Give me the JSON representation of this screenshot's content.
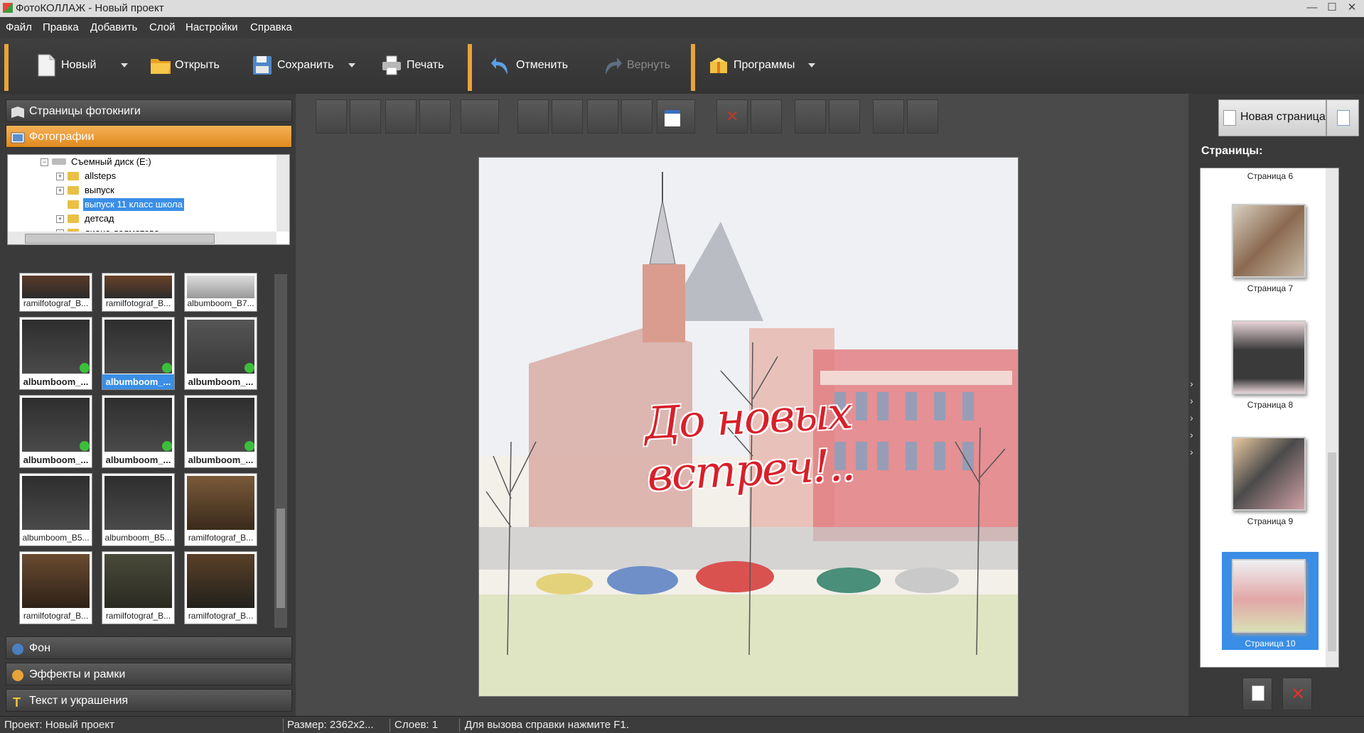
{
  "window": {
    "title": "ФотоКОЛЛАЖ - Новый проект"
  },
  "menu": [
    "Файл",
    "Правка",
    "Добавить",
    "Слой",
    "Настройки",
    "Справка"
  ],
  "toolbar": {
    "new": "Новый",
    "open": "Открыть",
    "save": "Сохранить",
    "print": "Печать",
    "undo": "Отменить",
    "redo": "Вернуть",
    "programs": "Программы"
  },
  "left_panel": {
    "sections": {
      "pages": "Страницы фотокниги",
      "photos": "Фотографии",
      "background": "Фон",
      "effects": "Эффекты и рамки",
      "text": "Текст и украшения"
    },
    "tree": {
      "drive": "Съемный диск (E:)",
      "folders": [
        "allsteps",
        "выпуск",
        "выпуск 11 класс школа",
        "детсад",
        "диана долматова"
      ],
      "selected": "выпуск 11 класс школа"
    },
    "thumbnails": [
      "ramilfotograf_B...",
      "ramilfotograf_B...",
      "albumboom_B7...",
      "albumboom_...",
      "albumboom_...",
      "albumboom_...",
      "albumboom_...",
      "albumboom_...",
      "albumboom_...",
      "albumboom_B5...",
      "albumboom_B5...",
      "ramilfotograf_B...",
      "ramilfotograf_B...",
      "ramilfotograf_B...",
      "ramilfotograf_B..."
    ]
  },
  "canvas": {
    "caption": "До новых встреч!.."
  },
  "right_panel": {
    "new_page": "Новая страница",
    "pages_label": "Страницы:",
    "pages": [
      "Страница 6",
      "Страница 7",
      "Страница 8",
      "Страница 9",
      "Страница 10"
    ],
    "selected_page": "Страница 10"
  },
  "status": {
    "project": "Проект:  Новый проект",
    "size": "Размер:  2362x2...",
    "layers": "Слоев:  1",
    "help": "Для вызова справки нажмите F1."
  },
  "colors": {
    "accent": "#e9a33a",
    "selection": "#3a8ee6",
    "caption": "#d8202a"
  }
}
